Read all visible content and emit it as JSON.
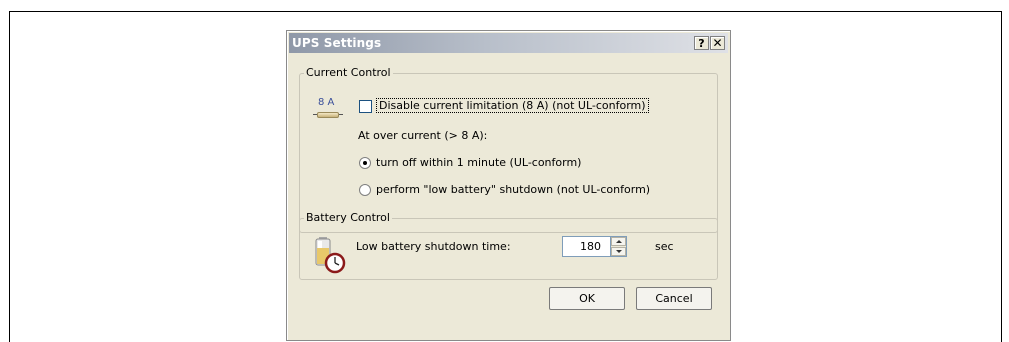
{
  "dialog": {
    "title": "UPS Settings",
    "help_label": "?",
    "close_label": "✕"
  },
  "current_control": {
    "group_label": "Current Control",
    "fuse_label": "8 A",
    "disable_label": "Disable current limitation (8 A) (not UL-conform)",
    "disable_checked": false,
    "over_current_label": "At over current (> 8 A):",
    "options": [
      {
        "label": "turn off within 1 minute (UL-conform)",
        "selected": true
      },
      {
        "label": "perform \"low battery\" shutdown (not UL-conform)",
        "selected": false
      }
    ]
  },
  "battery_control": {
    "group_label": "Battery Control",
    "shutdown_label": "Low battery shutdown time:",
    "shutdown_value": "180",
    "unit": "sec"
  },
  "buttons": {
    "ok": "OK",
    "cancel": "Cancel"
  }
}
